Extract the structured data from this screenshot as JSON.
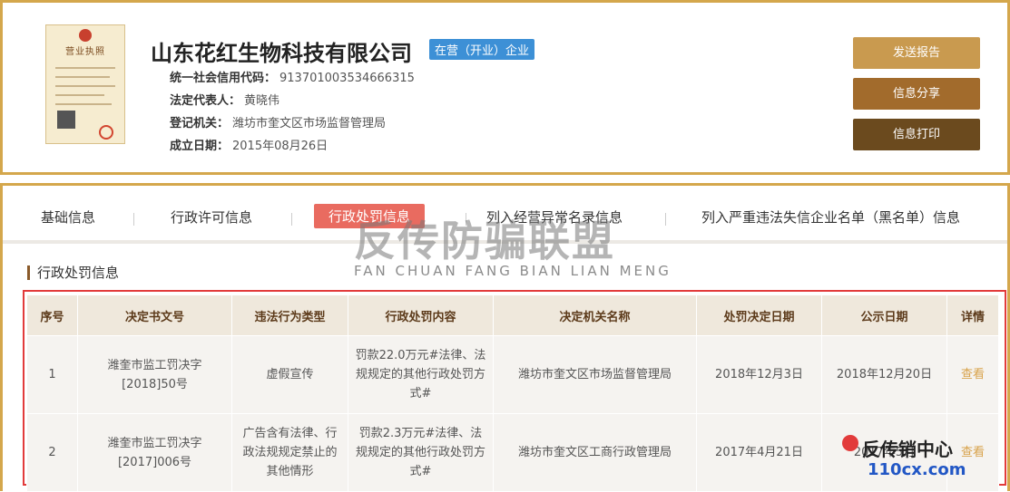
{
  "company": {
    "name": "山东花红生物科技有限公司",
    "status": "在营（开业）企业",
    "license_title": "营业执照",
    "fields": [
      {
        "label": "统一社会信用代码：",
        "value": "913701003534666315"
      },
      {
        "label": "法定代表人：",
        "value": "黄晓伟"
      },
      {
        "label": "登记机关：",
        "value": "潍坊市奎文区市场监督管理局"
      },
      {
        "label": "成立日期：",
        "value": "2015年08月26日"
      }
    ]
  },
  "actions": {
    "send": "发送报告",
    "share": "信息分享",
    "print": "信息打印"
  },
  "tabs": [
    "基础信息",
    "行政许可信息",
    "行政处罚信息",
    "列入经营异常名录信息",
    "列入严重违法失信企业名单（黑名单）信息"
  ],
  "section_title": "行政处罚信息",
  "table": {
    "headers": [
      "序号",
      "决定书文号",
      "违法行为类型",
      "行政处罚内容",
      "决定机关名称",
      "处罚决定日期",
      "公示日期",
      "详情"
    ],
    "rows": [
      [
        "1",
        "潍奎市监工罚决字[2018]50号",
        "虚假宣传",
        "罚款22.0万元#法律、法规规定的其他行政处罚方式#",
        "潍坊市奎文区市场监督管理局",
        "2018年12月3日",
        "2018年12月20日",
        "查看"
      ],
      [
        "2",
        "潍奎市监工罚决字[2017]006号",
        "广告含有法律、行政法规规定禁止的其他情形",
        "罚款2.3万元#法律、法规规定的其他行政处罚方式#",
        "潍坊市奎文区工商行政管理局",
        "2017年4月21日",
        "2017年5月",
        "查看"
      ]
    ]
  },
  "watermark": {
    "cn": "反传防骗联盟",
    "en": "FAN CHUAN FANG BIAN LIAN MENG"
  },
  "brand": {
    "line1": "反传销中心",
    "line2": "110cx.com"
  },
  "colors": {
    "accent": "#d4a74c",
    "active_tab": "#e96b60",
    "badge": "#3d90d6",
    "highlight_border": "#e23b3b"
  }
}
